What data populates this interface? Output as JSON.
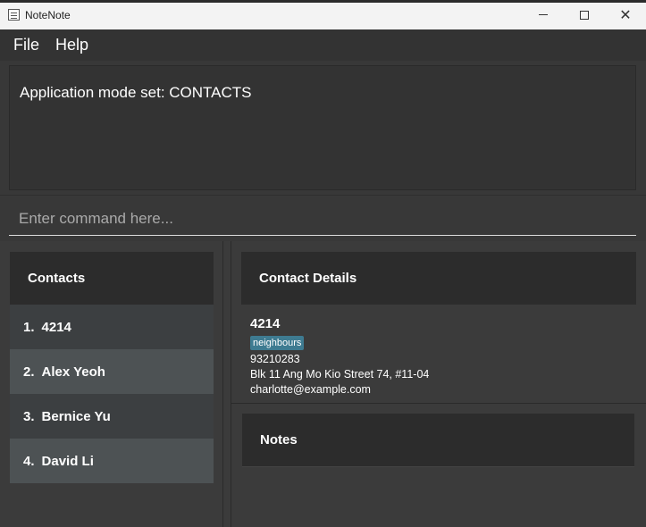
{
  "window": {
    "title": "NoteNote",
    "minimize_symbol": "",
    "close_symbol": "✕"
  },
  "menu": {
    "items": [
      "File",
      "Help"
    ]
  },
  "result": {
    "message": "Application mode set: CONTACTS"
  },
  "command": {
    "placeholder": "Enter command here...",
    "value": ""
  },
  "contacts": {
    "header": "Contacts",
    "items": [
      {
        "index": "1.",
        "name": "4214"
      },
      {
        "index": "2.",
        "name": "Alex Yeoh"
      },
      {
        "index": "3.",
        "name": "Bernice Yu"
      },
      {
        "index": "4.",
        "name": "David Li"
      }
    ]
  },
  "details": {
    "header": "Contact Details",
    "name": "4214",
    "tag": "neighbours",
    "phone": "93210283",
    "address": "Blk 11 Ang Mo Kio Street 74, #11-04",
    "email": "charlotte@example.com"
  },
  "notes": {
    "header": "Notes"
  },
  "colors": {
    "background": "#3b3b3b",
    "header_bg": "#2c2c2c",
    "row_odd": "#3c3f41",
    "row_even": "#4d5254",
    "tag": "#3e7b91"
  }
}
